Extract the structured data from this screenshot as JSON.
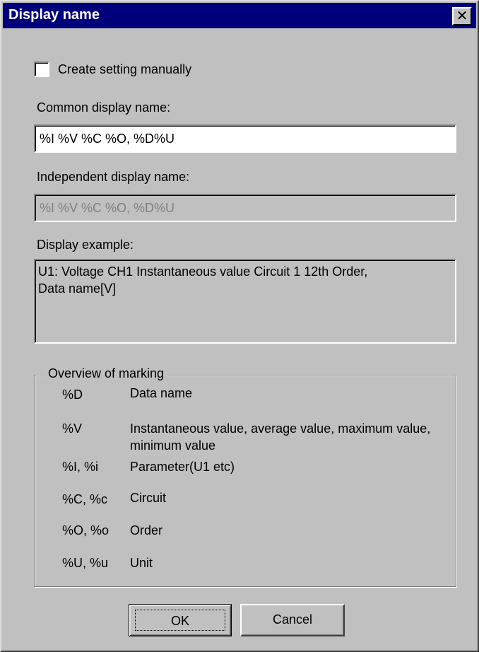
{
  "dialog": {
    "title": "Display name",
    "close_glyph": "✕"
  },
  "create_manually": {
    "label": "Create setting manually",
    "checked": false
  },
  "common": {
    "label": "Common display name:",
    "value": "%I %V %C %O, %D%U"
  },
  "independent": {
    "label": "Independent display name:",
    "value": "%I %V %C %O, %D%U"
  },
  "example": {
    "label": "Display example:",
    "line1": "U1: Voltage CH1 Instantaneous value Circuit 1 12th Order,",
    "line2": "Data name[V]"
  },
  "overview": {
    "title": "Overview of marking",
    "rows": [
      {
        "mark": "%D",
        "desc": "Data name"
      },
      {
        "mark": "%V",
        "desc": "Instantaneous value, average value, maximum value, minimum value"
      },
      {
        "mark": "%I, %i",
        "desc": "Parameter(U1 etc)"
      },
      {
        "mark": "%C, %c",
        "desc": "Circuit"
      },
      {
        "mark": "%O, %o",
        "desc": "Order"
      },
      {
        "mark": "%U, %u",
        "desc": "Unit"
      }
    ]
  },
  "buttons": {
    "ok": "OK",
    "cancel": "Cancel"
  }
}
